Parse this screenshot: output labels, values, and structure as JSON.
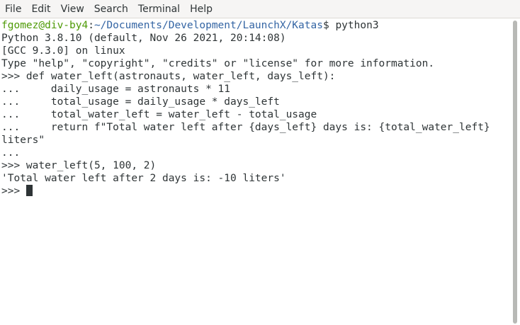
{
  "menu": {
    "items": [
      "File",
      "Edit",
      "View",
      "Search",
      "Terminal",
      "Help"
    ]
  },
  "terminal": {
    "prompt_user": "fgomez@div-by4",
    "prompt_sep": ":",
    "prompt_path": "~/Documents/Development/LaunchX/Katas",
    "prompt_end": "$ ",
    "command": "python3",
    "lines": [
      "Python 3.8.10 (default, Nov 26 2021, 20:14:08)",
      "[GCC 9.3.0] on linux",
      "Type \"help\", \"copyright\", \"credits\" or \"license\" for more information.",
      ">>> def water_left(astronauts, water_left, days_left):",
      "...     daily_usage = astronauts * 11",
      "...     total_usage = daily_usage * days_left",
      "...     total_water_left = water_left - total_usage",
      "...     return f\"Total water left after {days_left} days is: {total_water_left}",
      "liters\"",
      "...",
      ">>> water_left(5, 100, 2)",
      "'Total water left after 2 days is: -10 liters'"
    ],
    "current_prompt": ">>> "
  },
  "colors": {
    "user": "#4e9a06",
    "path": "#3465a4",
    "text": "#2e3436",
    "background": "#ffffff"
  }
}
